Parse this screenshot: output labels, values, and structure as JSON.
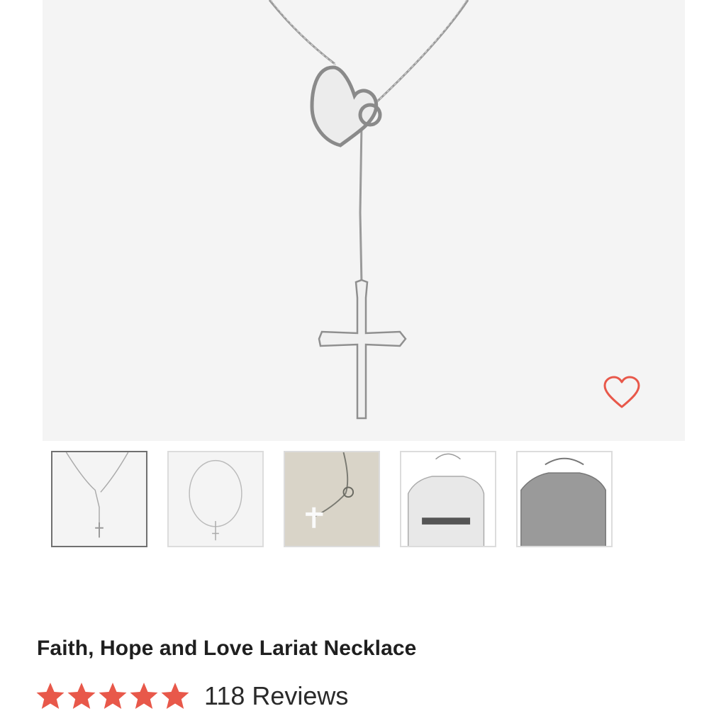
{
  "product": {
    "title": "Faith, Hope and Love Lariat Necklace",
    "rating": 5,
    "reviews_label": "118 Reviews"
  },
  "gallery": {
    "selected_index": 0,
    "thumbnails": [
      "necklace-closeup",
      "necklace-full",
      "necklace-on-linen",
      "model-size-chart-1",
      "model-size-chart-2"
    ]
  },
  "colors": {
    "accent": "#e8584a",
    "hero_bg": "#f4f4f4",
    "thumb_border": "#dcdcdc",
    "thumb_selected_border": "#707070"
  },
  "icons": {
    "favorite": "heart-outline-icon",
    "rating": "star-icon"
  }
}
